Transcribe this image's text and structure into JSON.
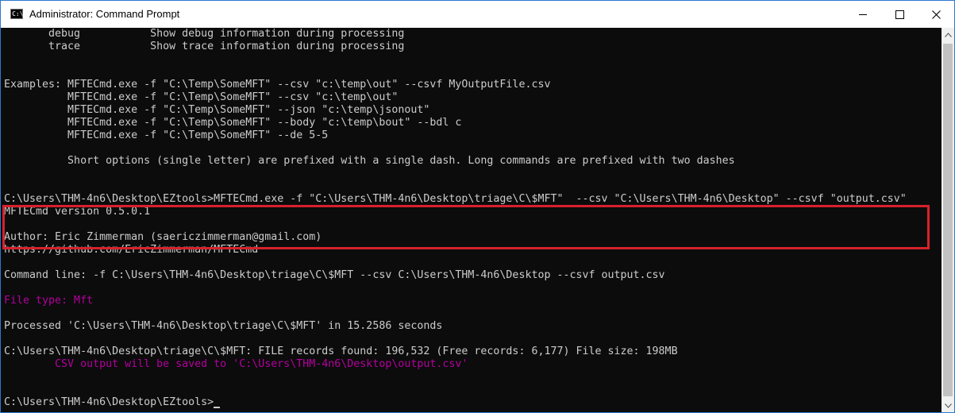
{
  "window": {
    "title": "Administrator: Command Prompt",
    "icon": "cmd-icon",
    "icon_text": "C:\\",
    "accent_border": "#2b79d0"
  },
  "console": {
    "background": "#0c0c0c",
    "foreground": "#cccccc",
    "magenta": "#b4009e",
    "lines": [
      "       debug           Show debug information during processing",
      "       trace           Show trace information during processing",
      "",
      "",
      "Examples: MFTECmd.exe -f \"C:\\Temp\\SomeMFT\" --csv \"c:\\temp\\out\" --csvf MyOutputFile.csv",
      "          MFTECmd.exe -f \"C:\\Temp\\SomeMFT\" --csv \"c:\\temp\\out\"",
      "          MFTECmd.exe -f \"C:\\Temp\\SomeMFT\" --json \"c:\\temp\\jsonout\"",
      "          MFTECmd.exe -f \"C:\\Temp\\SomeMFT\" --body \"c:\\temp\\bout\" --bdl c",
      "          MFTECmd.exe -f \"C:\\Temp\\SomeMFT\" --de 5-5",
      "",
      "          Short options (single letter) are prefixed with a single dash. Long commands are prefixed with two dashes",
      "",
      "",
      "C:\\Users\\THM-4n6\\Desktop\\EZtools>MFTECmd.exe -f \"C:\\Users\\THM-4n6\\Desktop\\triage\\C\\$MFT\"  --csv \"C:\\Users\\THM-4n6\\Desktop\" --csvf \"output.csv\"",
      "MFTECmd version 0.5.0.1",
      "",
      "Author: Eric Zimmerman (saericzimmerman@gmail.com)",
      "https://github.com/EricZimmerman/MFTECmd",
      "",
      "Command line: -f C:\\Users\\THM-4n6\\Desktop\\triage\\C\\$MFT --csv C:\\Users\\THM-4n6\\Desktop --csvf output.csv",
      "",
      "File type: Mft",
      "",
      "Processed 'C:\\Users\\THM-4n6\\Desktop\\triage\\C\\$MFT' in 15.2586 seconds",
      "",
      "C:\\Users\\THM-4n6\\Desktop\\triage\\C\\$MFT: FILE records found: 196,532 (Free records: 6,177) File size: 198MB",
      "        CSV output will be saved to 'C:\\Users\\THM-4n6\\Desktop\\output.csv'",
      "",
      "",
      "C:\\Users\\THM-4n6\\Desktop\\EZtools>"
    ]
  },
  "highlight": {
    "color": "#d7212b"
  }
}
